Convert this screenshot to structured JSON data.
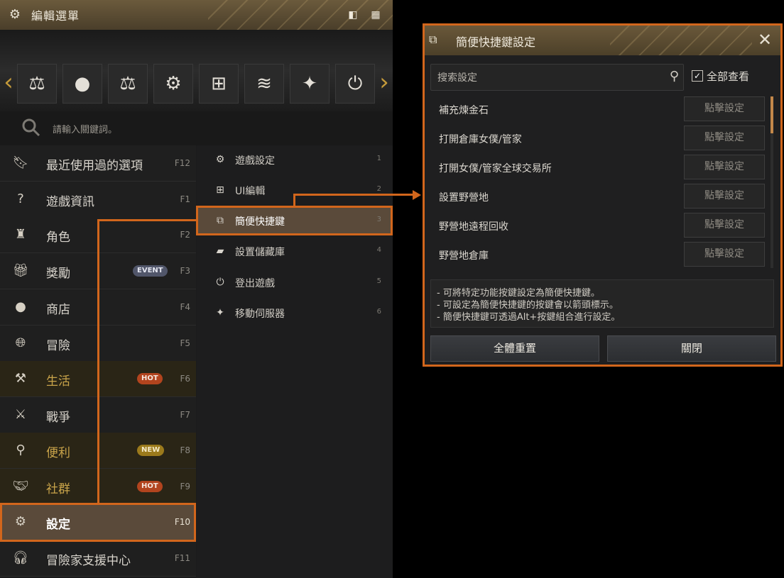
{
  "menu": {
    "title": "編輯選單",
    "search_placeholder": "請輸入關鍵詞。",
    "quick_icons": [
      "scale-book-icon",
      "shop-bag-icon",
      "scale-icon",
      "gear-icon",
      "ui-edit-icon",
      "lifeskill-icon",
      "server-move-icon",
      "power-icon"
    ],
    "items": [
      {
        "label": "最近使用過的選項",
        "key": "F12",
        "icon": "bookmark-icon",
        "badge": ""
      },
      {
        "label": "遊戲資訊",
        "key": "F1",
        "icon": "question-icon",
        "badge": ""
      },
      {
        "label": "角色",
        "key": "F2",
        "icon": "helmet-icon",
        "badge": ""
      },
      {
        "label": "獎勵",
        "key": "F3",
        "icon": "gift-icon",
        "badge": "EVENT"
      },
      {
        "label": "商店",
        "key": "F4",
        "icon": "shop-icon",
        "badge": ""
      },
      {
        "label": "冒險",
        "key": "F5",
        "icon": "globe-icon",
        "badge": ""
      },
      {
        "label": "生活",
        "key": "F6",
        "icon": "pickaxe-icon",
        "badge": "HOT"
      },
      {
        "label": "戰爭",
        "key": "F7",
        "icon": "war-emblem-icon",
        "badge": ""
      },
      {
        "label": "便利",
        "key": "F8",
        "icon": "magnifier-icon",
        "badge": "NEW"
      },
      {
        "label": "社群",
        "key": "F9",
        "icon": "handshake-icon",
        "badge": "HOT"
      },
      {
        "label": "設定",
        "key": "F10",
        "icon": "gear-icon",
        "badge": ""
      },
      {
        "label": "冒險家支援中心",
        "key": "F11",
        "icon": "headset-icon",
        "badge": ""
      }
    ],
    "sub_items": [
      {
        "label": "遊戲設定",
        "num": "1",
        "icon": "gear-icon"
      },
      {
        "label": "UI編輯",
        "num": "2",
        "icon": "ui-edit-icon"
      },
      {
        "label": "簡便快捷鍵",
        "num": "3",
        "icon": "shortcut-icon"
      },
      {
        "label": "設置儲藏庫",
        "num": "4",
        "icon": "folder-icon"
      },
      {
        "label": "登出遊戲",
        "num": "5",
        "icon": "power-icon"
      },
      {
        "label": "移動伺服器",
        "num": "6",
        "icon": "server-move-icon"
      }
    ]
  },
  "dialog": {
    "title": "簡便快捷鍵設定",
    "search_placeholder": "搜索設定",
    "view_all_label": "全部查看",
    "set_label": "點擊設定",
    "rows": [
      "補充煉金石",
      "打開倉庫女僕/管家",
      "打開女僕/管家全球交易所",
      "設置野營地",
      "野營地遠程回收",
      "野營地倉庫"
    ],
    "notes": [
      "- 可將特定功能按鍵設定為簡便快捷鍵。",
      "- 可設定為簡便快捷鍵的按鍵會以箭頭標示。",
      "- 簡便快捷鍵可透過Alt+按鍵組合進行設定。"
    ],
    "reset_label": "全體重置",
    "close_label": "關閉"
  },
  "colors": {
    "highlight": "#d2661c",
    "accent_gold": "#c9a44a",
    "hot": "#b2441e",
    "event": "#51566a",
    "new": "#9b7a1c"
  }
}
